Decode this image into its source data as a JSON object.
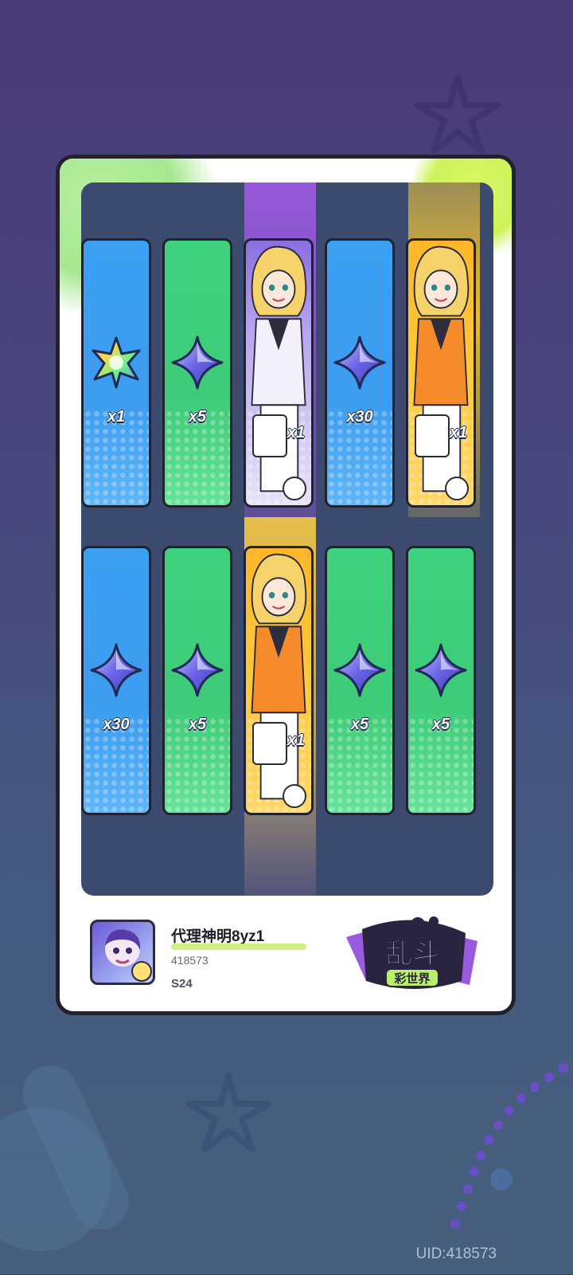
{
  "colors": {
    "bg_top": "#4a3a78",
    "bg_bottom": "#465f7c",
    "slot_blue": "#3aa0f2",
    "slot_green": "#3fd27e",
    "slot_purple": "#8a6fe0",
    "slot_gold": "#ffb62a",
    "panel": "#3b4a6e"
  },
  "rows": [
    [
      {
        "kind": "item",
        "color": "blue",
        "icon": "rainbow-star-icon",
        "qty": "x1"
      },
      {
        "kind": "item",
        "color": "green",
        "icon": "crystal-star-icon",
        "qty": "x5"
      },
      {
        "kind": "character",
        "color": "purple",
        "icon": "character-card",
        "qty": "x1"
      },
      {
        "kind": "item",
        "color": "blue",
        "icon": "crystal-star-icon",
        "qty": "x30"
      },
      {
        "kind": "character",
        "color": "gold",
        "icon": "character-card",
        "qty": "x1"
      }
    ],
    [
      {
        "kind": "item",
        "color": "blue",
        "icon": "crystal-star-icon",
        "qty": "x30"
      },
      {
        "kind": "item",
        "color": "green",
        "icon": "crystal-star-icon",
        "qty": "x5"
      },
      {
        "kind": "character",
        "color": "gold",
        "icon": "character-card",
        "qty": "x1"
      },
      {
        "kind": "item",
        "color": "green",
        "icon": "crystal-star-icon",
        "qty": "x5"
      },
      {
        "kind": "item",
        "color": "green",
        "icon": "crystal-star-icon",
        "qty": "x5"
      }
    ]
  ],
  "player": {
    "name": "代理神明8yz1",
    "id": "418573",
    "season": "S24"
  },
  "logo": {
    "main": "乱斗",
    "sub": "彩世界"
  },
  "uid": "UID:418573"
}
